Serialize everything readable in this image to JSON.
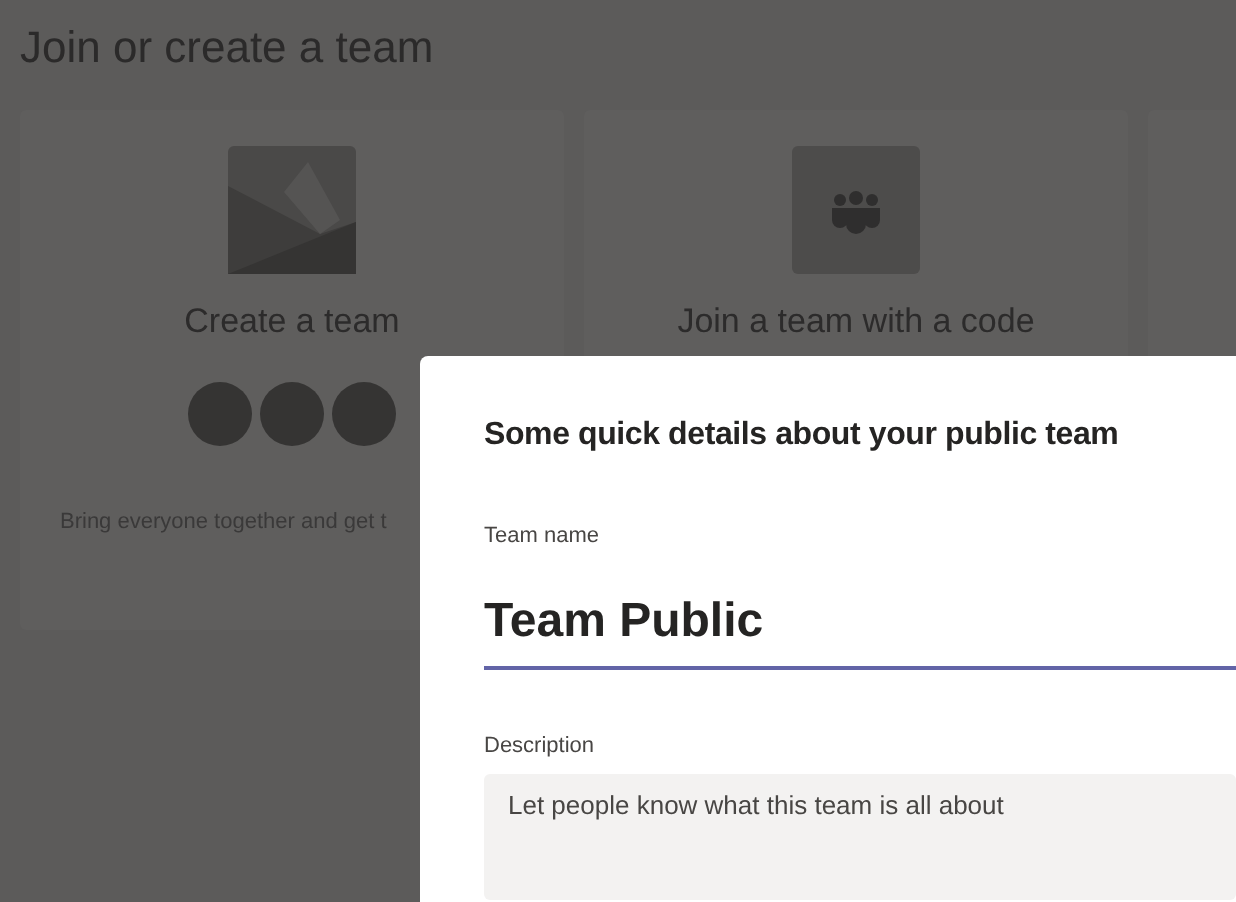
{
  "page": {
    "title": "Join or create a team"
  },
  "cards": [
    {
      "kind": "create",
      "title": "Create a team",
      "description": "Bring everyone together and get t"
    },
    {
      "kind": "join",
      "title": "Join a team with a code"
    },
    {
      "kind": "blank"
    }
  ],
  "dialog": {
    "title": "Some quick details about your public team",
    "fields": [
      {
        "kind": "input",
        "label": "Team name",
        "value": "Team Public",
        "focused": true
      },
      {
        "kind": "textarea",
        "label": "Description",
        "placeholder": "Let people know what this team is all about"
      }
    ]
  }
}
